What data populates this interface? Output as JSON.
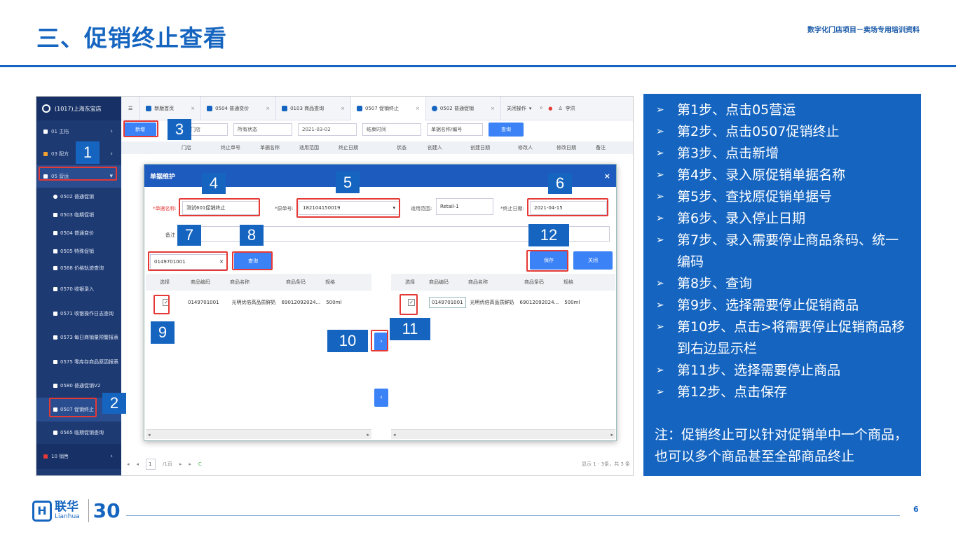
{
  "slide": {
    "title": "三、促销终止查看",
    "subtitle": "数字化门店项目－卖场专用培训资料",
    "page_number": "6",
    "brand_cn": "联华",
    "brand_en": "Lianhua",
    "brand_30": "30"
  },
  "sidebar": {
    "store": "(1017)上海东宝店",
    "items": [
      {
        "label": "01 主档"
      },
      {
        "label": "03 配方"
      },
      {
        "label": "05 营运"
      }
    ],
    "sub": [
      "0502 普通促销",
      "0503 临期促销",
      "0504 普通变价",
      "0505 特殊促销",
      "0568 价格轨迹查询",
      "0570 收银录入",
      "0571 收银操作日志查询",
      "0573 每日商销量预警报表",
      "0575 零库存商品原因报表",
      "0580 普通促销V2",
      "0507 促销终止",
      "0565 临期促销查询"
    ],
    "bottom": "10 销售"
  },
  "tabs": [
    "新版首页",
    "0504 普通变价",
    "0103 商品查询",
    "0507 促销终止",
    "0502 普通促销"
  ],
  "tabs_extra": {
    "close_ops": "关闭操作",
    "user": "李洪"
  },
  "toolbar": {
    "new": "新增",
    "store": "请选择门店",
    "status": "所有状态",
    "date": "2021-03-02",
    "end_time": "结束时间",
    "doc_placeholder": "单据名称/编号",
    "query": "查询"
  },
  "list_header": [
    "门店",
    "终止单号",
    "单据名称",
    "适用范围",
    "终止日期",
    "状态",
    "创建人",
    "创建日期",
    "修改人",
    "修改日期",
    "备注"
  ],
  "modal": {
    "title": "单据维护",
    "doc_name_label": "*单据名称:",
    "doc_name": "测试601促销终止",
    "orig_no_label": "*原单号:",
    "orig_no": "182104150019",
    "scope_label": "适用范围:",
    "scope": "Retail-1",
    "end_date_label": "*终止日期:",
    "end_date": "2021-04-15",
    "remark_label": "备注",
    "search_value": "0149701001",
    "query": "查询",
    "save": "保存",
    "close": "关闭",
    "grid_header": [
      "选择",
      "商品编码",
      "商品名称",
      "商品条码",
      "规格"
    ],
    "row": [
      "0149701001",
      "光明优倍高品质鲜奶",
      "69012092024...",
      "500ml"
    ],
    "move_right": "›",
    "move_left": "‹"
  },
  "pager": {
    "page": "1",
    "total": "/1页",
    "summary": "显示 1 - 3条，共 3 条"
  },
  "numbers": [
    "1",
    "2",
    "3",
    "4",
    "5",
    "6",
    "7",
    "8",
    "9",
    "10",
    "11",
    "12"
  ],
  "steps": [
    "第1步、点击05营运",
    "第2步、点击0507促销终止",
    "第3步、点击新增",
    "第4步、录入原促销单据名称",
    "第5步、查找原促销单据号",
    "第6步、录入停止日期",
    "第7步、录入需要停止商品条码、统一编码",
    "第8步、查询",
    "第9步、选择需要停止促销商品",
    "第10步、点击>将需要停止促销商品移到右边显示栏",
    "第11步、选择需要停止商品",
    "第12步、点击保存"
  ],
  "note": "注：促销终止可以针对促销单中一个商品，也可以多个商品甚至全部商品终止"
}
